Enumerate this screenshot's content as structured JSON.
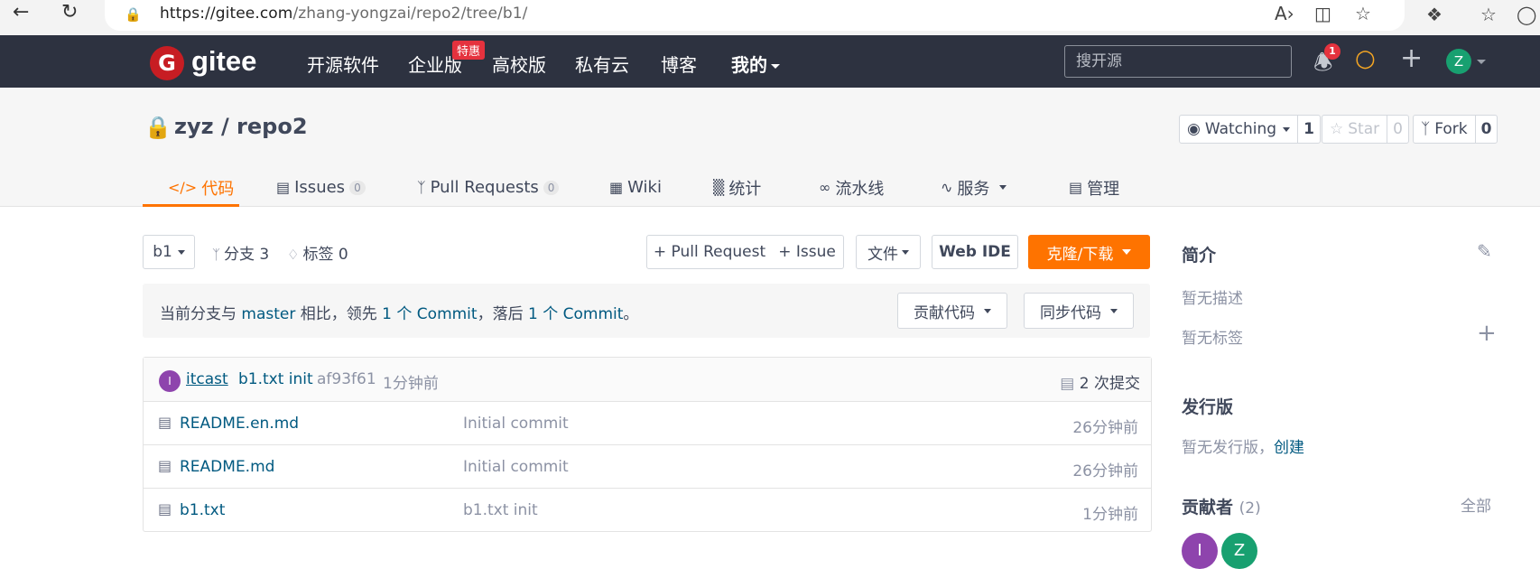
{
  "browser": {
    "url_host": "https://gitee.com",
    "url_path": "/zhang-yongzai/repo2/tree/b1/"
  },
  "topnav": {
    "logo_text": "gitee",
    "menu": [
      "开源软件",
      "企业版",
      "高校版",
      "私有云",
      "博客",
      "我的"
    ],
    "hot_badge": "特惠",
    "search_placeholder": "搜开源",
    "notification_count": "1",
    "avatar_letter": "Z",
    "colors": {
      "bar": "#2d3240",
      "hot": "#e5323e",
      "avatar": "#18a070",
      "bulb": "#f5a623"
    }
  },
  "repo": {
    "title": "zyz / repo2",
    "watch_label": "Watching",
    "watch_count": "1",
    "star_label": "Star",
    "star_count": "0",
    "fork_label": "Fork",
    "fork_count": "0",
    "tabs": [
      {
        "label": "代码",
        "icon": "code-icon"
      },
      {
        "label": "Issues",
        "count": "0",
        "icon": "issues-icon"
      },
      {
        "label": "Pull Requests",
        "count": "0",
        "icon": "pull-request-icon"
      },
      {
        "label": "Wiki",
        "icon": "wiki-icon"
      },
      {
        "label": "统计",
        "icon": "stats-icon"
      },
      {
        "label": "流水线",
        "icon": "pipeline-icon"
      },
      {
        "label": "服务",
        "icon": "service-icon"
      },
      {
        "label": "管理",
        "icon": "manage-icon"
      }
    ]
  },
  "toolbar": {
    "branch": "b1",
    "branches": "分支 3",
    "tags": "标签 0",
    "pull_request": "+ Pull Request",
    "issue": "+ Issue",
    "file": "文件",
    "web_ide": "Web IDE",
    "clone": "克隆/下载",
    "accent": "#fe7300"
  },
  "compare": {
    "prefix": "当前分支与",
    "branch": "master",
    "mid1": "相比，领先",
    "ahead": "1 个 Commit",
    "mid2": "，落后",
    "behind": "1 个 Commit",
    "suffix": "。",
    "contribute": "贡献代码",
    "sync": "同步代码"
  },
  "commit": {
    "avatar_letter": "I",
    "user": "itcast",
    "message": "b1.txt init",
    "sha": "af93f61",
    "time": "1分钟前",
    "count": "2 次提交"
  },
  "files": [
    {
      "name": "README.en.md",
      "message": "Initial commit",
      "time": "26分钟前"
    },
    {
      "name": "README.md",
      "message": "Initial commit",
      "time": "26分钟前"
    },
    {
      "name": "b1.txt",
      "message": "b1.txt init",
      "time": "1分钟前"
    }
  ],
  "sidebar": {
    "intro_title": "简介",
    "no_desc": "暂无描述",
    "no_tags": "暂无标签",
    "release_title": "发行版",
    "no_release": "暂无发行版，",
    "create": "创建",
    "contrib_title": "贡献者",
    "contrib_count": "(2)",
    "all": "全部",
    "contrib_avatars": [
      "I",
      "Z"
    ]
  }
}
